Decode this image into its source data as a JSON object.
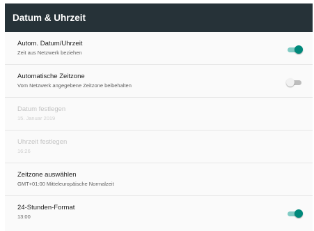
{
  "colors": {
    "appbar": "#263238",
    "accent": "#00897b",
    "accent_track": "#80cbc4",
    "disabled_text": "#c3c3c3"
  },
  "header": {
    "title": "Datum & Uhrzeit"
  },
  "settings": [
    {
      "title": "Autom. Datum/Uhrzeit",
      "summary": "Zeit aus Netzwerk beziehen",
      "toggle": "on"
    },
    {
      "title": "Automatische Zeitzone",
      "summary": "Vom Netzwerk angegebene Zeitzone beibehalten",
      "toggle": "off"
    },
    {
      "title": "Datum festlegen",
      "summary": "15. Januar 2019",
      "disabled": true
    },
    {
      "title": "Uhrzeit festlegen",
      "summary": "16:26",
      "disabled": true
    },
    {
      "title": "Zeitzone auswählen",
      "summary": "GMT+01:00 Mitteleuropäische Normalzeit"
    },
    {
      "title": "24-Stunden-Format",
      "summary": "13:00",
      "toggle": "on"
    }
  ]
}
